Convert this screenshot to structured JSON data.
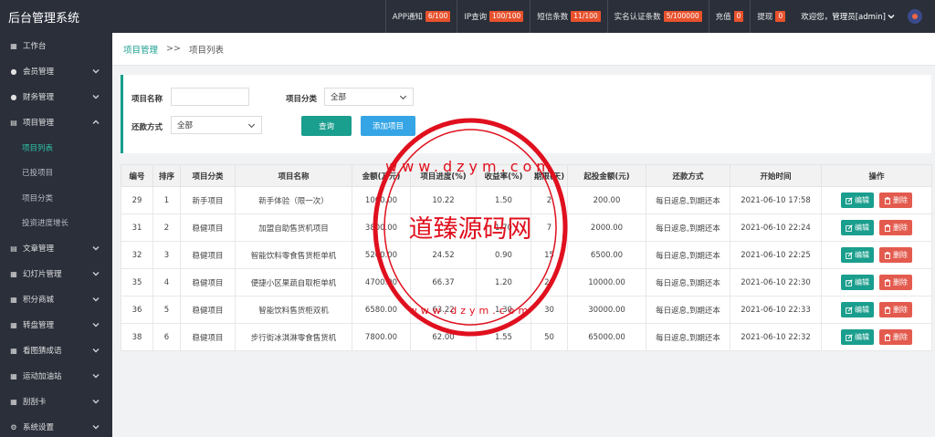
{
  "app": {
    "title": "后台管理系统"
  },
  "header": {
    "stats": [
      {
        "label": "APP通知",
        "value": "6/100"
      },
      {
        "label": "IP查询",
        "value": "100/100"
      },
      {
        "label": "短信条数",
        "value": "11/100"
      },
      {
        "label": "实名认证条数",
        "value": "5/100000"
      },
      {
        "label": "充值",
        "value": "0"
      },
      {
        "label": "提现",
        "value": "0"
      }
    ],
    "welcome": "欢迎您，管理员[admin]"
  },
  "sidebar": {
    "items": [
      {
        "label": "工作台",
        "icon": "dashboard-icon",
        "glyph": "▦",
        "chevron": ""
      },
      {
        "label": "会员管理",
        "icon": "user-icon",
        "glyph": "●",
        "chevron": "down"
      },
      {
        "label": "财务管理",
        "icon": "finance-icon",
        "glyph": "●",
        "chevron": "down"
      },
      {
        "label": "项目管理",
        "icon": "project-icon",
        "glyph": "▤",
        "chevron": "up"
      },
      {
        "label": "文章管理",
        "icon": "article-icon",
        "glyph": "▤",
        "chevron": "down"
      },
      {
        "label": "幻灯片管理",
        "icon": "slides-icon",
        "glyph": "▦",
        "chevron": "down"
      },
      {
        "label": "积分商城",
        "icon": "points-icon",
        "glyph": "▦",
        "chevron": "down"
      },
      {
        "label": "转盘管理",
        "icon": "wheel-icon",
        "glyph": "▦",
        "chevron": "down"
      },
      {
        "label": "看图猜成语",
        "icon": "puzzle-icon",
        "glyph": "▦",
        "chevron": "down"
      },
      {
        "label": "运动加油站",
        "icon": "sport-icon",
        "glyph": "▦",
        "chevron": "down"
      },
      {
        "label": "刮刮卡",
        "icon": "card-icon",
        "glyph": "▦",
        "chevron": "down"
      },
      {
        "label": "系统设置",
        "icon": "gear-icon",
        "glyph": "⚙",
        "chevron": "down"
      }
    ],
    "subitems": [
      {
        "label": "项目列表",
        "active": true
      },
      {
        "label": "已投项目",
        "active": false
      },
      {
        "label": "项目分类",
        "active": false
      },
      {
        "label": "投资进度增长",
        "active": false
      }
    ]
  },
  "breadcrumb": {
    "parent": "项目管理",
    "separator": ">>",
    "current": "项目列表"
  },
  "search": {
    "name_label": "项目名称",
    "name_value": "",
    "category_label": "项目分类",
    "category_value": "全部",
    "repay_label": "还款方式",
    "repay_value": "全部",
    "query_button": "查询",
    "add_button": "添加项目"
  },
  "table": {
    "columns": [
      "编号",
      "排序",
      "项目分类",
      "项目名称",
      "金额(万元)",
      "项目进度(%)",
      "收益率(%)",
      "期限(天)",
      "起投金额(元)",
      "还款方式",
      "开始时间",
      "操作"
    ],
    "rows": [
      [
        "29",
        "1",
        "新手项目",
        "新手体验（限一次）",
        "1000.00",
        "10.22",
        "1.50",
        "2",
        "200.00",
        "每日返息,到期还本",
        "2021-06-10 17:58"
      ],
      [
        "31",
        "2",
        "稳健项目",
        "加盟自助售货机项目",
        "3800.00",
        "",
        "1.70",
        "7",
        "2000.00",
        "每日返息,到期还本",
        "2021-06-10 22:24"
      ],
      [
        "32",
        "3",
        "稳健项目",
        "智能饮料零食售货柜单机",
        "5200.00",
        "24.52",
        "0.90",
        "15",
        "6500.00",
        "每日返息,到期还本",
        "2021-06-10 22:25"
      ],
      [
        "35",
        "4",
        "稳健项目",
        "便捷小区果蔬自取柜单机",
        "4700.00",
        "66.37",
        "1.20",
        "20",
        "10000.00",
        "每日返息,到期还本",
        "2021-06-10 22:30"
      ],
      [
        "36",
        "5",
        "稳健项目",
        "智能饮料售货柜双机",
        "6580.00",
        "63.22",
        "1.30",
        "30",
        "30000.00",
        "每日返息,到期还本",
        "2021-06-10 22:33"
      ],
      [
        "38",
        "6",
        "稳健项目",
        "步行街冰淇淋零食售货机",
        "7800.00",
        "62.00",
        "1.55",
        "50",
        "65000.00",
        "每日返息,到期还本",
        "2021-06-10 22:32"
      ]
    ],
    "edit_label": "编辑",
    "delete_label": "删除"
  },
  "watermark": {
    "text": "道臻源码网",
    "url_text": "www.dzym.com"
  },
  "colors": {
    "sidebar_bg": "#2a2f3a",
    "accent": "#1a9e8d",
    "blue": "#35a5e5",
    "danger": "#e35b4e",
    "badge": "#e8522d",
    "stamp": "#e0101e"
  }
}
